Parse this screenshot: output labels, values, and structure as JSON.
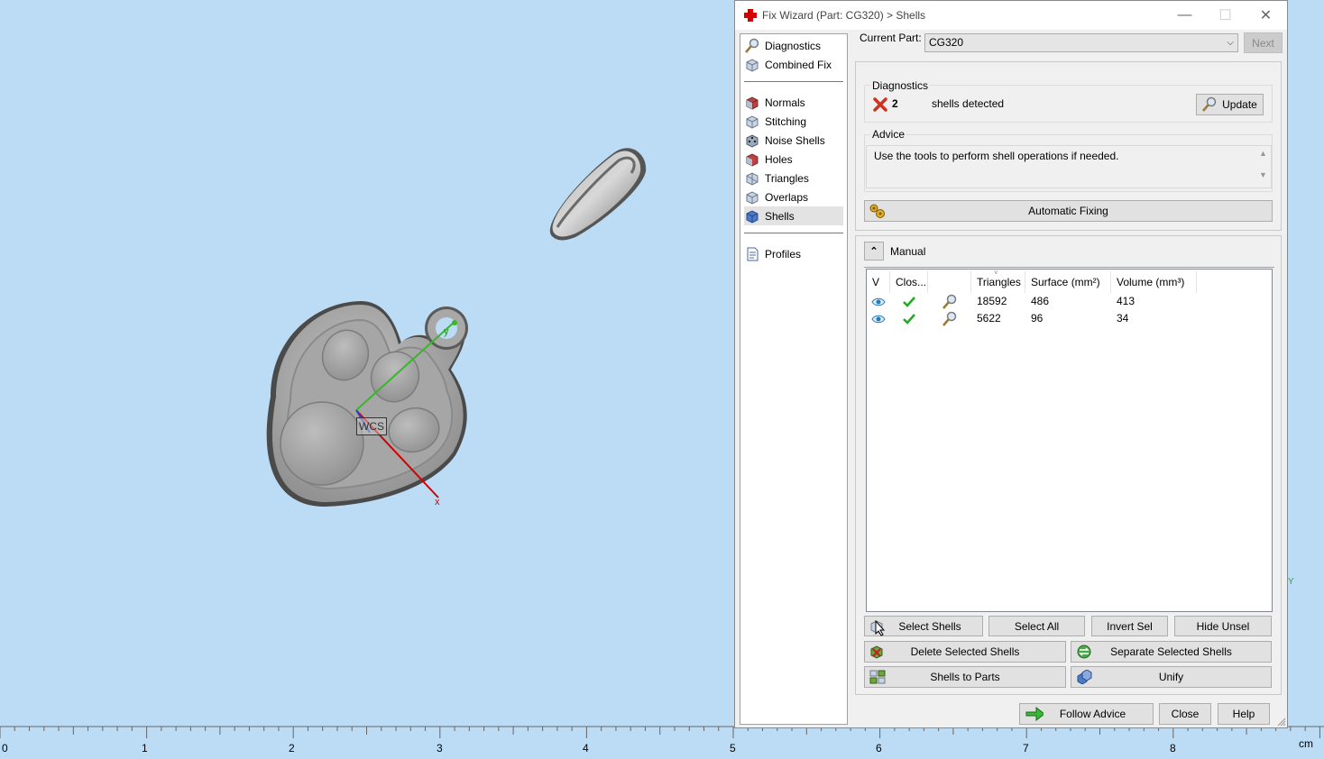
{
  "viewport": {
    "ruler_labels": [
      "0",
      "1",
      "2",
      "3",
      "4",
      "5",
      "6",
      "7",
      "8"
    ],
    "ruler_unit": "cm",
    "wcs_label": "WCS",
    "axis_x": "x",
    "axis_y": "y",
    "corner_y": "Y"
  },
  "dialog": {
    "title": "Fix Wizard (Part: CG320) > Shells",
    "minimize": "—",
    "maximize": "☐",
    "close": "✕"
  },
  "nav": {
    "items": [
      {
        "label": "Diagnostics",
        "icon": "magnifier-icon"
      },
      {
        "label": "Combined Fix",
        "icon": "cube-icon"
      },
      {
        "label": "Normals",
        "icon": "cube-red-icon"
      },
      {
        "label": "Stitching",
        "icon": "cube-icon"
      },
      {
        "label": "Noise Shells",
        "icon": "dice-icon"
      },
      {
        "label": "Holes",
        "icon": "cube-red-icon"
      },
      {
        "label": "Triangles",
        "icon": "cube-icon"
      },
      {
        "label": "Overlaps",
        "icon": "cube-icon"
      },
      {
        "label": "Shells",
        "icon": "cube-blue-icon",
        "active": true
      },
      {
        "label": "Profiles",
        "icon": "document-icon"
      }
    ]
  },
  "current_part": {
    "label": "Current Part:",
    "value": "CG320",
    "next_label": "Next"
  },
  "diagnostics": {
    "title": "Diagnostics",
    "count": "2",
    "status_text": "shells detected",
    "update_label": "Update"
  },
  "advice": {
    "title": "Advice",
    "text": "Use the tools to perform shell operations if needed.",
    "automatic_fixing_label": "Automatic Fixing"
  },
  "manual": {
    "title": "Manual",
    "columns": [
      "V",
      "Clos...",
      "",
      "Triangles",
      "Surface (mm²)",
      "Volume (mm³)"
    ],
    "rows": [
      {
        "triangles": "18592",
        "surface": "486",
        "volume": "413"
      },
      {
        "triangles": "5622",
        "surface": "96",
        "volume": "34"
      }
    ],
    "buttons": {
      "select_shells": "Select Shells",
      "select_all": "Select All",
      "invert_sel": "Invert Sel",
      "hide_unsel": "Hide Unsel",
      "delete_selected": "Delete Selected Shells",
      "separate_selected": "Separate Selected Shells",
      "shells_to_parts": "Shells to Parts",
      "unify": "Unify"
    }
  },
  "footer": {
    "follow_advice": "Follow Advice",
    "close": "Close",
    "help": "Help"
  },
  "colors": {
    "viewport_bg": "#bcdcf6",
    "error": "#d40000",
    "check": "#22aa22"
  }
}
